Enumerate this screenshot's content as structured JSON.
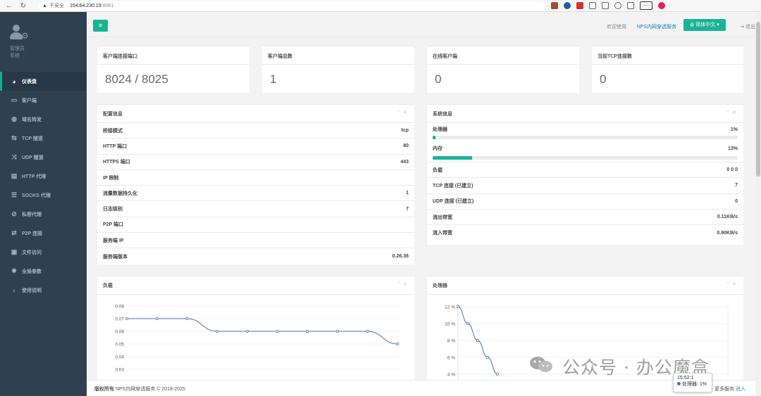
{
  "browser": {
    "security_label": "不安全",
    "url_host": "154.64.230.19",
    "url_port": ":8081"
  },
  "sidebar": {
    "user_name": "管理员",
    "user_role": "系统",
    "items": [
      {
        "label": "仪表盘",
        "icon": "dashboard-icon",
        "glyph": "◕"
      },
      {
        "label": "客户端",
        "icon": "monitor-icon",
        "glyph": "▭"
      },
      {
        "label": "域名转发",
        "icon": "globe-icon",
        "glyph": "◍"
      },
      {
        "label": "TCP 隧道",
        "icon": "swap-icon",
        "glyph": "⇆"
      },
      {
        "label": "UDP 隧道",
        "icon": "shuffle-icon",
        "glyph": "⤨"
      },
      {
        "label": "HTTP 代理",
        "icon": "server-icon",
        "glyph": "▤"
      },
      {
        "label": "SOCKS 代理",
        "icon": "stack-icon",
        "glyph": "☰"
      },
      {
        "label": "私密代理",
        "icon": "eye-slash-icon",
        "glyph": "⊘"
      },
      {
        "label": "P2P 连接",
        "icon": "exchange-icon",
        "glyph": "⇄"
      },
      {
        "label": "文件访问",
        "icon": "briefcase-icon",
        "glyph": "▣"
      },
      {
        "label": "全局参数",
        "icon": "gear-icon",
        "glyph": "✹"
      },
      {
        "label": "使用说明",
        "icon": "bulb-icon",
        "glyph": "♁"
      }
    ]
  },
  "topnav": {
    "welcome": "欢迎使用",
    "nps_link": "NPS内网穿透服务",
    "language": "简体中文",
    "logout": "退出"
  },
  "stats": [
    {
      "title": "客户端连接端口",
      "value": "8024 / 8025"
    },
    {
      "title": "客户端总数",
      "value": "1"
    },
    {
      "title": "在线客户端",
      "value": "0"
    },
    {
      "title": "当前TCP连接数",
      "value": "0"
    }
  ],
  "config": {
    "title": "配置信息",
    "rows": [
      {
        "label": "桥接模式",
        "value": "tcp"
      },
      {
        "label": "HTTP 端口",
        "value": "80"
      },
      {
        "label": "HTTPS 端口",
        "value": "443"
      },
      {
        "label": "IP 限制",
        "value": ""
      },
      {
        "label": "流量数据持久化",
        "value": "1"
      },
      {
        "label": "日志级别",
        "value": "7"
      },
      {
        "label": "P2P 端口",
        "value": ""
      },
      {
        "label": "服务端 IP",
        "value": ""
      },
      {
        "label": "服务端版本",
        "value": "0.26.36"
      }
    ]
  },
  "system": {
    "title": "系统信息",
    "cpu_label": "处理器",
    "cpu_value": "1%",
    "cpu_fraction": 0.01,
    "mem_label": "内存",
    "mem_value": "13%",
    "mem_fraction": 0.13,
    "rows": [
      {
        "label": "负载",
        "value": "0  0  0"
      },
      {
        "label": "TCP 连接 (已建立)",
        "value": "7"
      },
      {
        "label": "UDP 连接 (已建立)",
        "value": "0"
      },
      {
        "label": "流出带宽",
        "value": "0.11KB/s"
      },
      {
        "label": "流入带宽",
        "value": "0.90KB/s"
      }
    ]
  },
  "chart_data": [
    {
      "type": "line",
      "title": "负载",
      "y_ticks": [
        "0.08",
        "0.07",
        "0.06",
        "0.05",
        "0.04",
        "0.03"
      ],
      "ylim": [
        0.03,
        0.08
      ],
      "values": [
        0.07,
        0.07,
        0.07,
        0.06,
        0.06,
        0.06,
        0.06,
        0.06,
        0.06,
        0.05
      ],
      "grid": true,
      "color": "#4c6fbf"
    },
    {
      "type": "line",
      "title": "处理器",
      "y_ticks": [
        "12 %",
        "10 %",
        "8 %",
        "6 %",
        "4 %"
      ],
      "ylim": [
        4,
        12
      ],
      "values": [
        12,
        10,
        8,
        6,
        4
      ],
      "grid": true,
      "color": "#4c6fbf"
    }
  ],
  "tooltip": {
    "time": "15:52:1",
    "series": "处理器: 1%"
  },
  "footer": {
    "copyright_bold": "版权所有",
    "copyright": " NPS内网穿透服务 © 2018-2025",
    "more": "更多服务",
    "enter": "进入"
  },
  "watermark": "公众号 · 办公魔盒",
  "colors": {
    "accent": "#1ab394",
    "sidebar": "#2f4050",
    "link": "#1c84c6",
    "chart_line": "#4c6fbf"
  }
}
